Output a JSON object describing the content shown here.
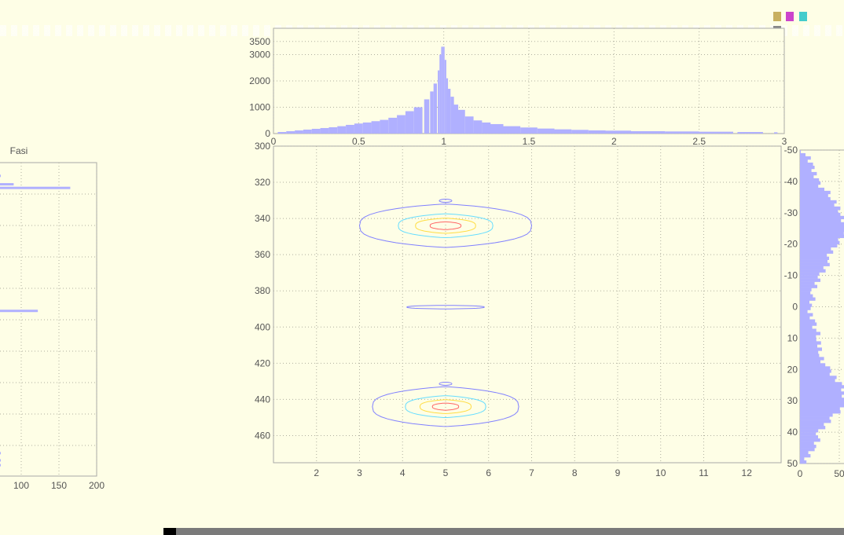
{
  "window": {
    "toolbar_icons": [
      "zoom-icon",
      "pan-icon",
      "rotate-icon",
      "datacursor-icon"
    ]
  },
  "colors": {
    "background": "#fefee6",
    "histogram_bar": "#b0b0ff",
    "contour_outer": "#8080ff",
    "contour_mid": "#66ddff",
    "contour_inner": "#ffdd44",
    "contour_core": "#ff6666"
  },
  "chart_data": [
    {
      "id": "top-histogram",
      "type": "bar",
      "title": "",
      "xlabel": "",
      "ylabel": "",
      "xlim": [
        0,
        3
      ],
      "ylim": [
        0,
        4000
      ],
      "xticks": [
        "0",
        "0.5",
        "1",
        "1.5",
        "2",
        "2.5",
        "3"
      ],
      "yticks": [
        "0",
        "1000",
        "2000",
        "3000",
        "3500"
      ],
      "grid": true,
      "x": [
        0.05,
        0.1,
        0.15,
        0.2,
        0.25,
        0.3,
        0.35,
        0.4,
        0.45,
        0.5,
        0.55,
        0.6,
        0.65,
        0.7,
        0.75,
        0.8,
        0.85,
        0.9,
        0.93,
        0.95,
        0.97,
        0.98,
        0.99,
        1.0,
        1.01,
        1.02,
        1.03,
        1.05,
        1.07,
        1.1,
        1.15,
        1.2,
        1.25,
        1.3,
        1.4,
        1.5,
        1.6,
        1.7,
        1.8,
        1.9,
        2.0,
        2.2,
        2.4,
        2.6,
        2.8,
        2.95
      ],
      "values": [
        60,
        90,
        120,
        150,
        180,
        210,
        240,
        280,
        330,
        380,
        420,
        470,
        520,
        600,
        700,
        850,
        1000,
        1300,
        1600,
        1900,
        2400,
        3000,
        3300,
        3300,
        2800,
        2100,
        1700,
        1400,
        1100,
        900,
        650,
        500,
        420,
        360,
        280,
        230,
        190,
        160,
        140,
        120,
        110,
        90,
        80,
        70,
        60,
        50
      ]
    },
    {
      "id": "contour-plot",
      "type": "contour",
      "title": "",
      "xlabel": "",
      "ylabel": "",
      "xlim": [
        1,
        12.8
      ],
      "ylim": [
        300,
        475
      ],
      "y_reversed": true,
      "xticks": [
        "2",
        "3",
        "4",
        "5",
        "6",
        "7",
        "8",
        "9",
        "10",
        "11",
        "12"
      ],
      "yticks": [
        "300",
        "320",
        "340",
        "360",
        "380",
        "400",
        "420",
        "440",
        "460"
      ],
      "grid": true,
      "peaks": [
        {
          "x": 5,
          "y": 344,
          "x_halfwidth": 2.0,
          "y_halfwidth": 12
        },
        {
          "x": 5,
          "y": 389,
          "x_halfwidth": 0.9,
          "y_halfwidth": 1
        },
        {
          "x": 5,
          "y": 444,
          "x_halfwidth": 1.7,
          "y_halfwidth": 11
        }
      ]
    },
    {
      "id": "right-histogram",
      "type": "bar",
      "orientation": "horizontal",
      "title": "",
      "xlabel": "",
      "ylabel": "",
      "xlim": [
        0,
        70
      ],
      "ylim": [
        -50,
        50
      ],
      "y_reversed": true,
      "xticks": [
        "0",
        "50"
      ],
      "yticks": [
        "-50",
        "-40",
        "-30",
        "-20",
        "-10",
        "0",
        "10",
        "20",
        "30",
        "40",
        "50"
      ],
      "grid": true,
      "y": [
        -50,
        -45,
        -40,
        -35,
        -30,
        -25,
        -20,
        -15,
        -10,
        -5,
        0,
        5,
        10,
        15,
        20,
        25,
        30,
        35,
        40,
        45,
        50
      ],
      "values": [
        5,
        15,
        25,
        40,
        55,
        60,
        45,
        35,
        25,
        18,
        10,
        20,
        22,
        28,
        35,
        55,
        60,
        40,
        25,
        15,
        5
      ]
    },
    {
      "id": "left-histogram",
      "type": "bar",
      "orientation": "horizontal",
      "title": "Fasi",
      "xlabel": "",
      "ylabel": "",
      "xlim": [
        0,
        200
      ],
      "xticks": [
        "100",
        "150",
        "200"
      ],
      "grid": true,
      "y": [
        290,
        297,
        300,
        402,
        520,
        526,
        530
      ],
      "values": [
        40,
        90,
        165,
        122,
        15,
        45,
        30
      ]
    }
  ]
}
